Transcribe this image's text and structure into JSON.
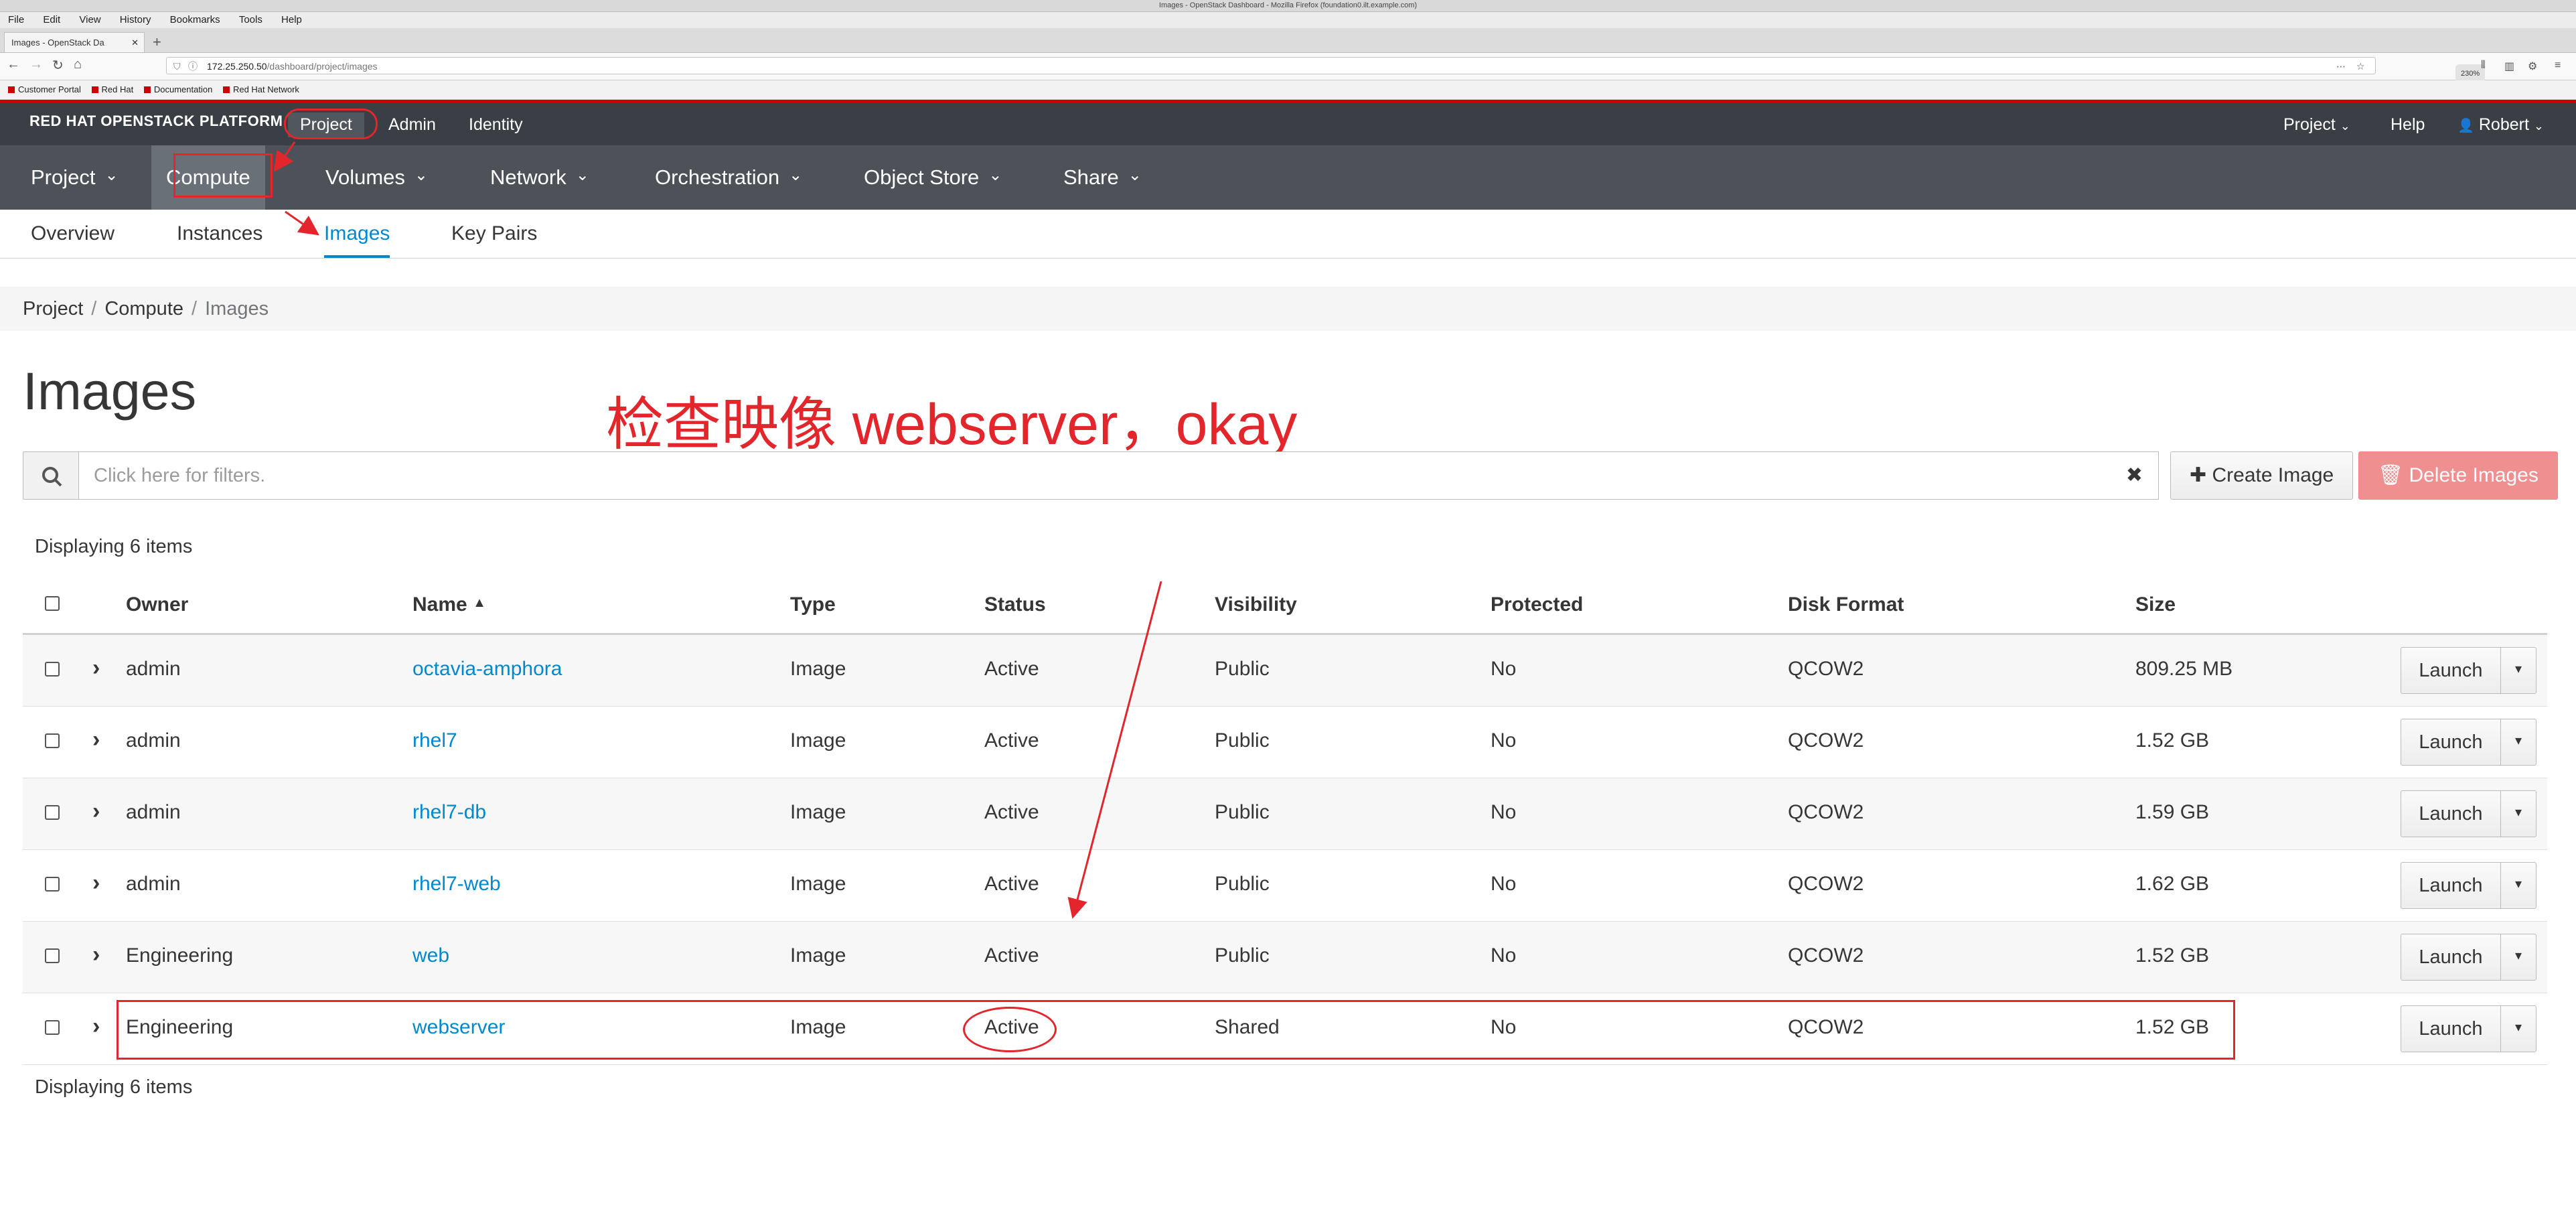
{
  "browser": {
    "window_title": "Images - OpenStack Dashboard - Mozilla Firefox (foundation0.ilt.example.com)",
    "menu": [
      "File",
      "Edit",
      "View",
      "History",
      "Bookmarks",
      "Tools",
      "Help"
    ],
    "tab_title": "Images - OpenStack Da",
    "url_host": "172.25.250.50",
    "url_path": "/dashboard/project/images",
    "zoom": "230%",
    "bookmarks": [
      "Customer Portal",
      "Red Hat",
      "Documentation",
      "Red Hat Network"
    ]
  },
  "topbar": {
    "brand": "RED HAT OPENSTACK PLATFORM",
    "nav": [
      "Project",
      "Admin",
      "Identity"
    ],
    "right": {
      "project": "Project",
      "help": "Help",
      "user": "Robert"
    }
  },
  "secnav": [
    "Project",
    "Compute",
    "Volumes",
    "Network",
    "Orchestration",
    "Object Store",
    "Share"
  ],
  "thirdnav": [
    "Overview",
    "Instances",
    "Images",
    "Key Pairs"
  ],
  "breadcrumb": [
    "Project",
    "Compute",
    "Images"
  ],
  "page": {
    "title": "Images",
    "annotation": "检查映像 webserver，okay",
    "filter_placeholder": "Click here for filters.",
    "create_label": "Create Image",
    "delete_label": "Delete Images",
    "displaying": "Displaying 6 items"
  },
  "table": {
    "headers": [
      "Owner",
      "Name",
      "Type",
      "Status",
      "Visibility",
      "Protected",
      "Disk Format",
      "Size"
    ],
    "launch_label": "Launch",
    "rows": [
      [
        "admin",
        "octavia-amphora",
        "Image",
        "Active",
        "Public",
        "No",
        "QCOW2",
        "809.25 MB"
      ],
      [
        "admin",
        "rhel7",
        "Image",
        "Active",
        "Public",
        "No",
        "QCOW2",
        "1.52 GB"
      ],
      [
        "admin",
        "rhel7-db",
        "Image",
        "Active",
        "Public",
        "No",
        "QCOW2",
        "1.59 GB"
      ],
      [
        "admin",
        "rhel7-web",
        "Image",
        "Active",
        "Public",
        "No",
        "QCOW2",
        "1.62 GB"
      ],
      [
        "Engineering",
        "web",
        "Image",
        "Active",
        "Public",
        "No",
        "QCOW2",
        "1.52 GB"
      ],
      [
        "Engineering",
        "webserver",
        "Image",
        "Active",
        "Shared",
        "No",
        "QCOW2",
        "1.52 GB"
      ]
    ]
  },
  "colors": {
    "accent": "#0088ce",
    "annotation": "#e3262b",
    "header_bg": "#393f44",
    "nav_bg": "#4d5258"
  }
}
